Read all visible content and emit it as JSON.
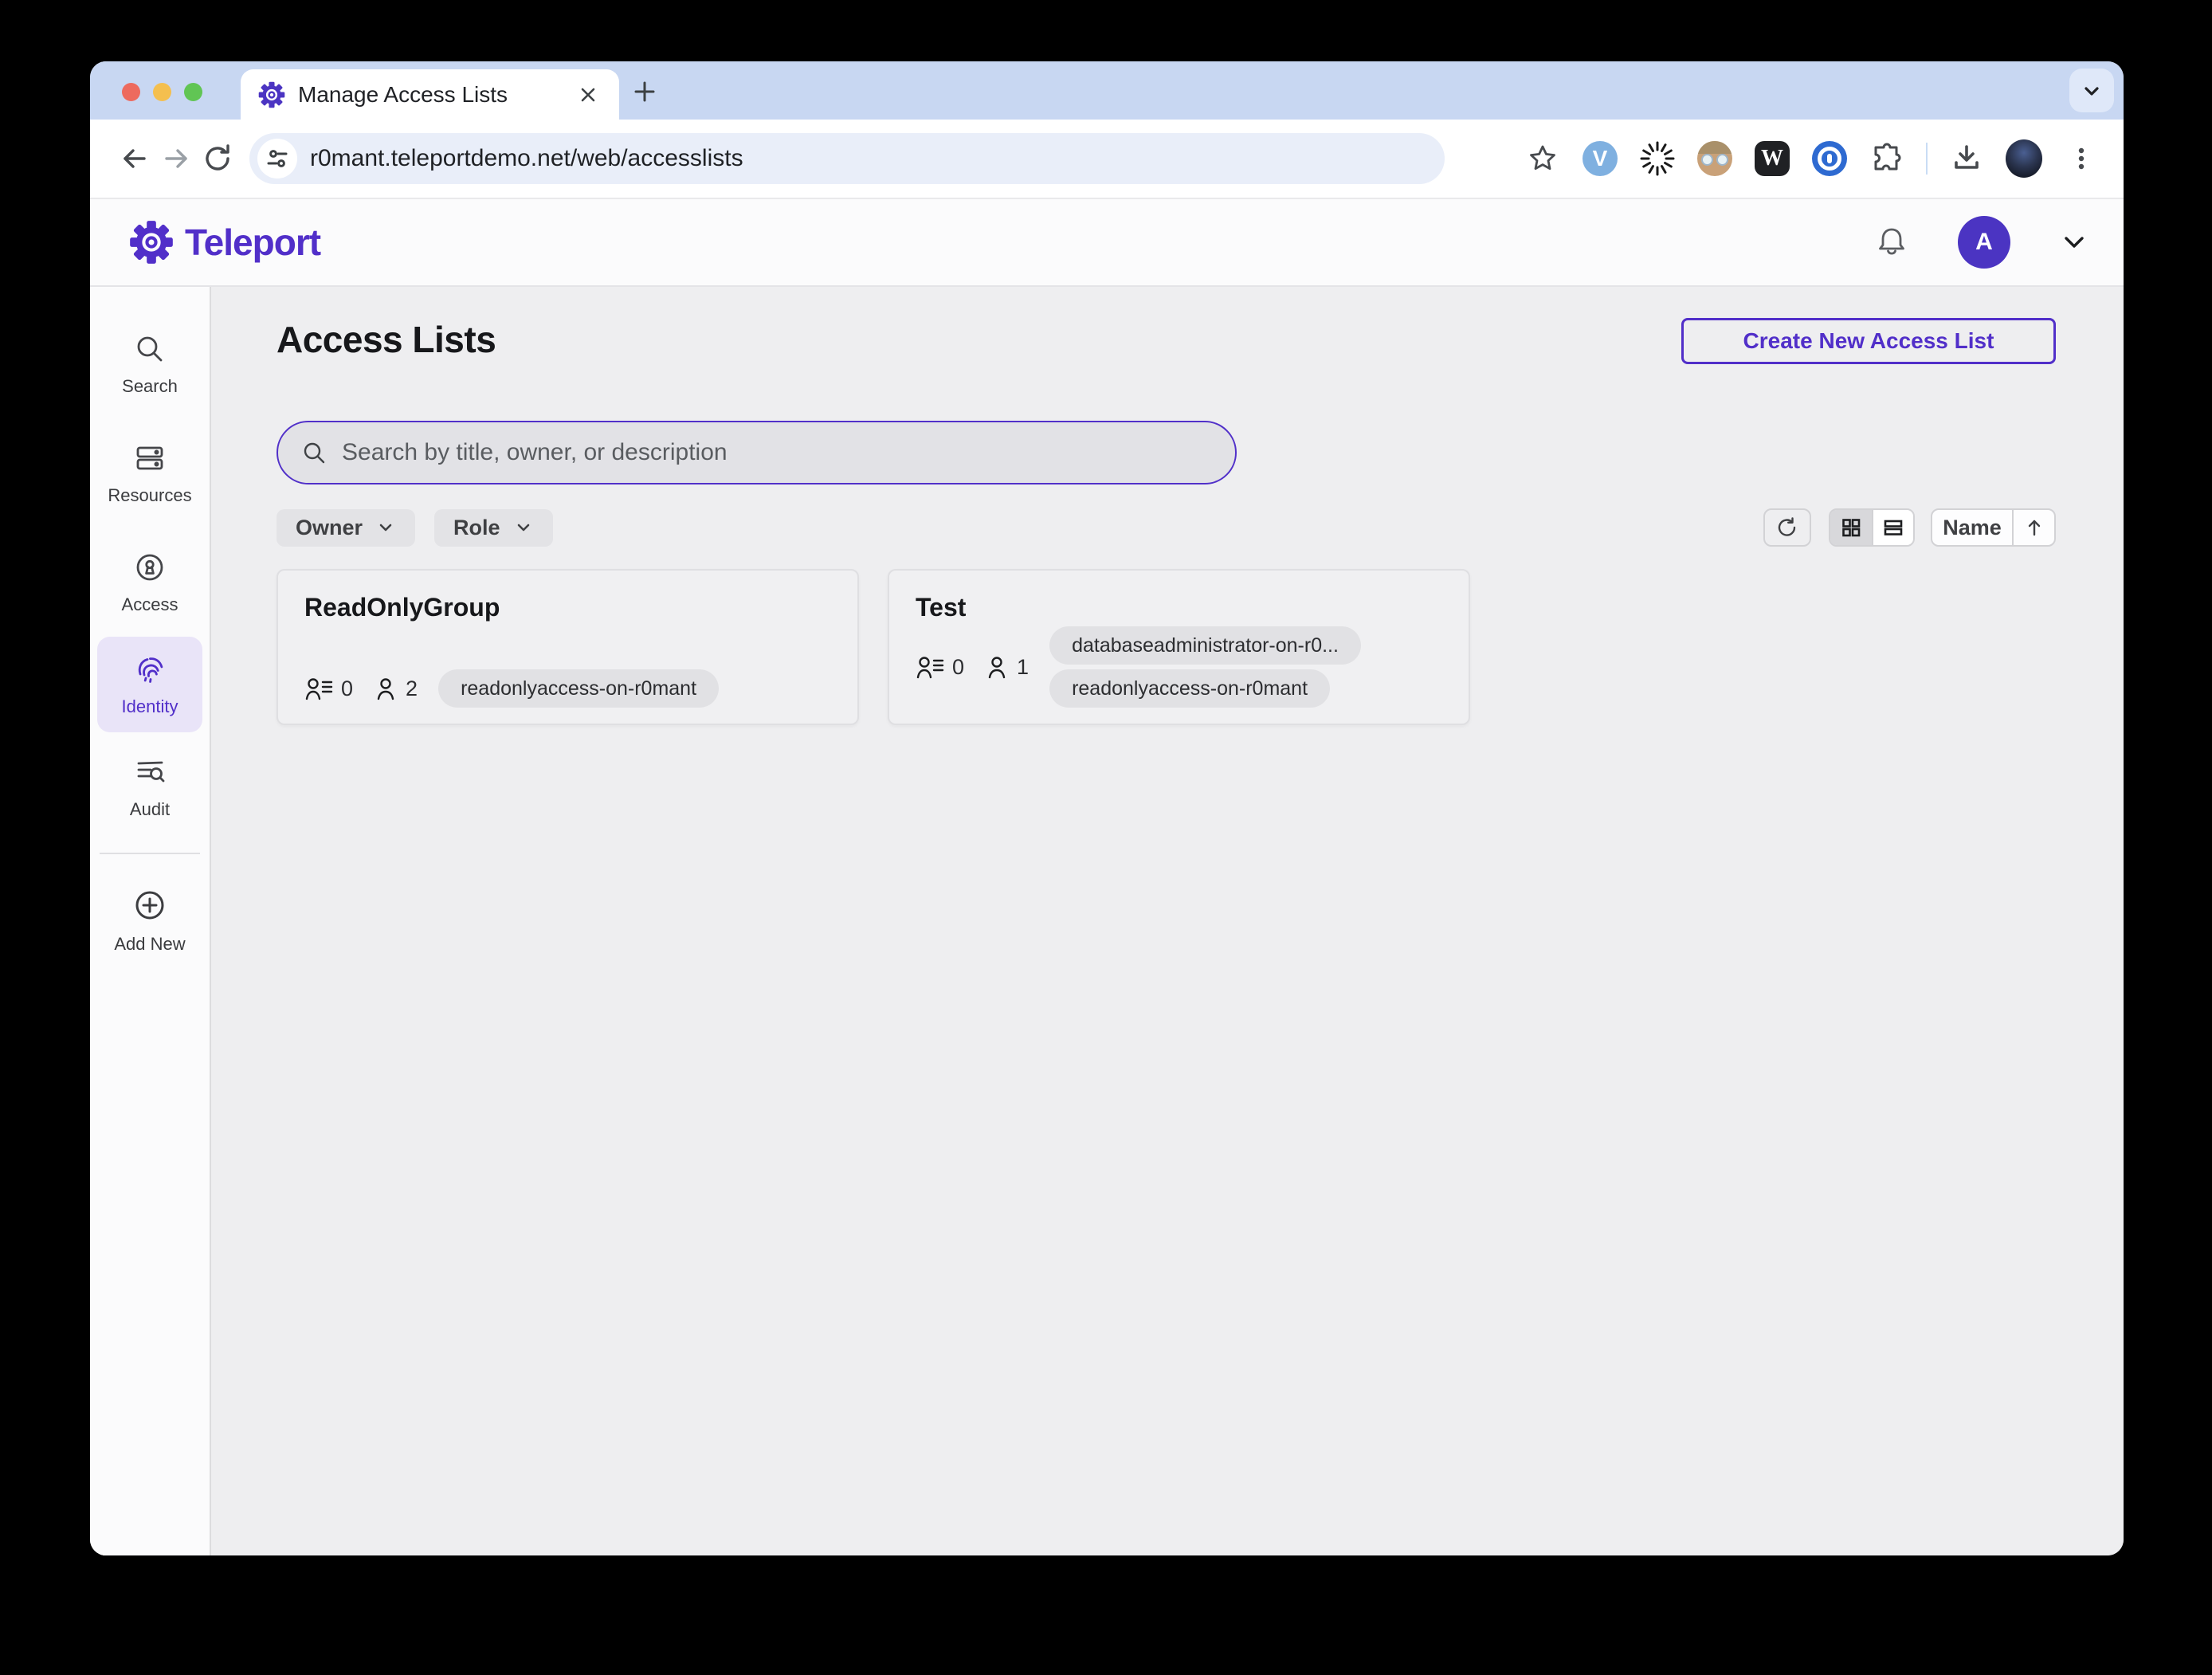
{
  "colors": {
    "brand_purple": "#512fc9",
    "tabstrip_blue": "#c8d7f2",
    "page_bg": "#eeeef0",
    "panel_bg": "#fbfbfc",
    "active_nav_bg": "#e9e4f8"
  },
  "browser": {
    "tab": {
      "title": "Manage Access Lists"
    },
    "url": "r0mant.teleportdemo.net/web/accesslists",
    "extensions": {
      "vimium_letter": "V",
      "wikipedia_letter": "W"
    }
  },
  "header": {
    "brand": "Teleport",
    "avatar_initial": "A"
  },
  "sidebar": {
    "items": [
      {
        "label": "Search"
      },
      {
        "label": "Resources"
      },
      {
        "label": "Access"
      },
      {
        "label": "Identity",
        "active": true
      },
      {
        "label": "Audit"
      }
    ],
    "add_new": {
      "label": "Add New"
    }
  },
  "main": {
    "title": "Access Lists",
    "create_button": "Create New Access List",
    "search_placeholder": "Search by title, owner, or description",
    "filters": [
      {
        "label": "Owner"
      },
      {
        "label": "Role"
      }
    ],
    "sort": {
      "label": "Name"
    },
    "cards": [
      {
        "title": "ReadOnlyGroup",
        "lists_count": "0",
        "members_count": "2",
        "roles": [
          "readonlyaccess-on-r0mant"
        ]
      },
      {
        "title": "Test",
        "lists_count": "0",
        "members_count": "1",
        "roles": [
          "databaseadministrator-on-r0...",
          "readonlyaccess-on-r0mant"
        ]
      }
    ]
  }
}
